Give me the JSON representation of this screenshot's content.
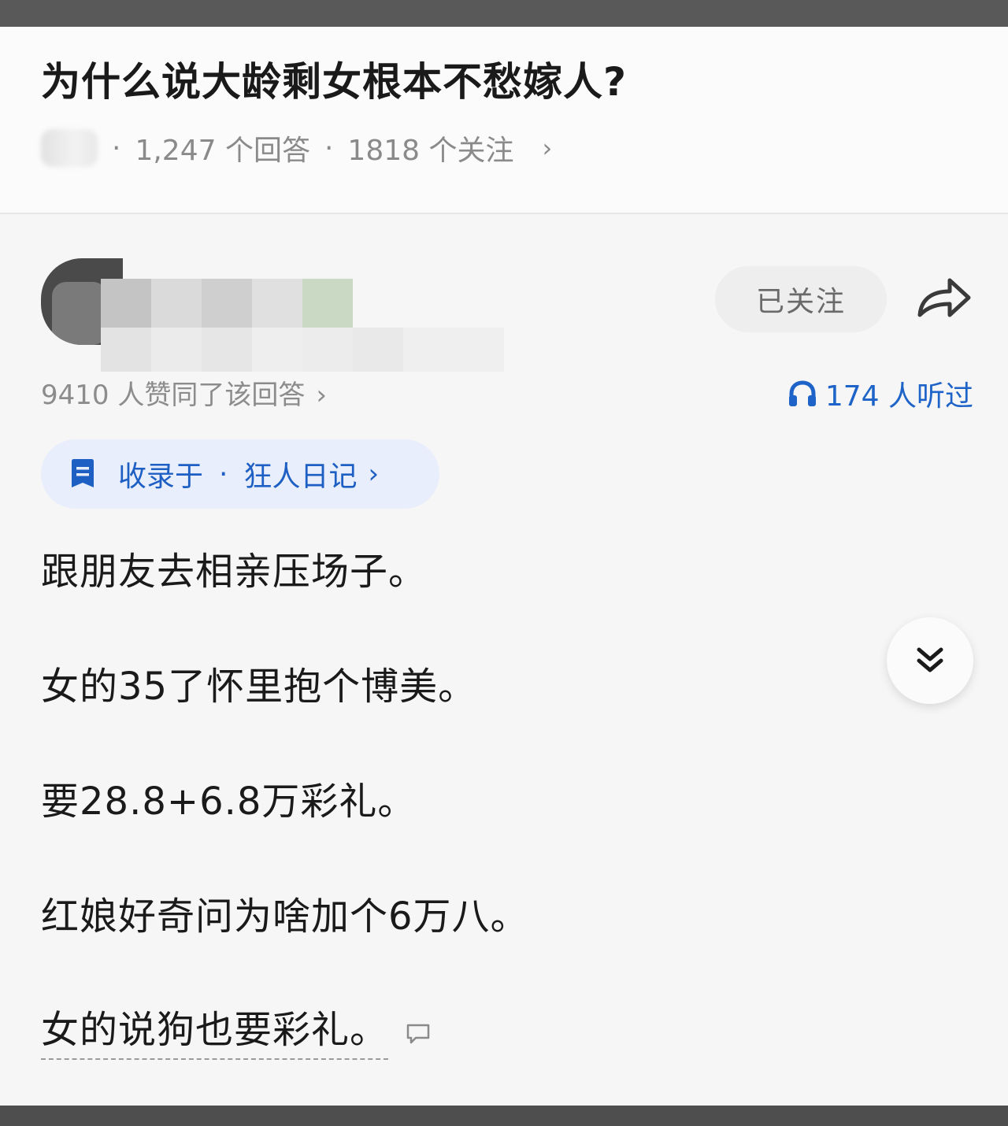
{
  "question": {
    "title": "为什么说大龄剩女根本不愁嫁人?",
    "answers_count": "1,247 个回答",
    "followers_count": "1818 个关注",
    "separator": "·",
    "chevron": "›"
  },
  "author": {
    "follow_label": "已关注",
    "share_icon": "share-arrow-icon"
  },
  "stats": {
    "votes": "9410 人赞同了该回答",
    "listened": "174 人听过",
    "chevron": "›",
    "listen_icon": "headphones-icon"
  },
  "collection": {
    "label": "收录于",
    "separator": "·",
    "name": "狂人日记",
    "chevron": "›",
    "icon": "bookmark-icon"
  },
  "content": {
    "paragraphs": [
      "跟朋友去相亲压场子。",
      "女的35了怀里抱个博美。",
      "要28.8+6.8万彩礼。",
      "红娘好奇问为啥加个6万八。",
      "女的说狗也要彩礼。"
    ]
  },
  "colors": {
    "accent_blue": "#1e63c8",
    "text_primary": "#1a1a1a",
    "text_secondary": "#8a8a8a",
    "collection_bg": "#e8eefb"
  }
}
